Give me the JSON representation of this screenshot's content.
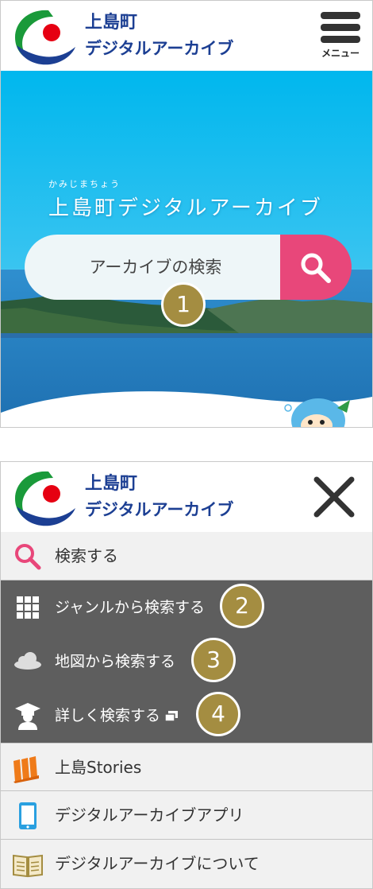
{
  "colors": {
    "brand_blue": "#1c3f93",
    "accent_pink": "#e8477a",
    "badge_gold": "#a48d41",
    "dark_menu": "#5e5e5e",
    "light_menu": "#f1f1f1"
  },
  "header": {
    "title_line1": "上島町",
    "title_line2": "デジタルアーカイブ",
    "menu_label": "メニュー"
  },
  "hero": {
    "ruby": "かみじまちょう",
    "title": "上島町デジタルアーカイブ",
    "search_placeholder": "アーカイブの検索",
    "badge": "1"
  },
  "menu": {
    "search": {
      "label": "検索する",
      "icon": "search-icon"
    },
    "genre": {
      "label": "ジャンルから検索する",
      "icon": "grid-icon",
      "badge": "2"
    },
    "map": {
      "label": "地図から検索する",
      "icon": "cloud-icon",
      "badge": "3"
    },
    "advanced": {
      "label": "詳しく検索する",
      "icon": "graduate-icon",
      "badge": "4"
    },
    "stories": {
      "label": "上島Stories",
      "icon": "books-icon"
    },
    "app": {
      "label": "デジタルアーカイブアプリ",
      "icon": "smartphone-icon"
    },
    "about": {
      "label": "デジタルアーカイブについて",
      "icon": "open-book-icon"
    }
  }
}
